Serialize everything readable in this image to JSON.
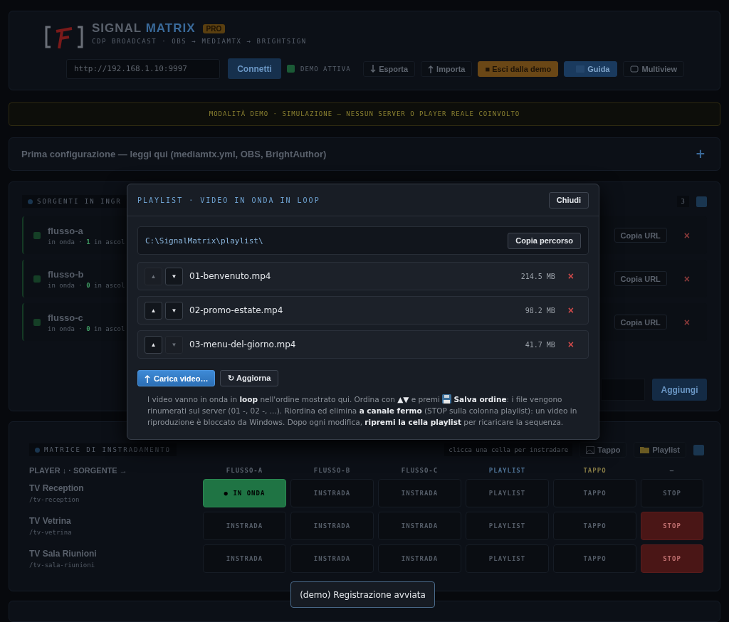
{
  "header": {
    "title_a": "SIGNAL",
    "title_b": "MATRIX",
    "badge": "PRO",
    "subtitle": "CDP BROADCAST · OBS → MEDIAMTX → BRIGHTSIGN",
    "server_url": "http://192.168.1.10:9997",
    "connect": "Connetti",
    "demo": {
      "label": "DEMO ATTIVA",
      "checked": true
    },
    "buttons": [
      {
        "kind": "export",
        "label": "Esporta"
      },
      {
        "kind": "import",
        "label": "Importa"
      },
      {
        "kind": "exit_demo",
        "label": "■ Esci dalla demo"
      },
      {
        "kind": "guide",
        "label": "Guida"
      },
      {
        "kind": "multiview",
        "label": "Multiview"
      }
    ]
  },
  "demo_banner": "MODALITÀ DEMO · SIMULAZIONE — NESSUN SERVER O PLAYER REALE COINVOLTO",
  "setup_accordion": {
    "title": "Prima configurazione — leggi qui (mediamtx.yml, OBS, BrightAuthor)",
    "toggle": "+",
    "expanded": false
  },
  "sources": {
    "title": "SORGENTI IN INGR",
    "count": "3",
    "items": [
      {
        "name": "flusso-a",
        "status": "in onda · ",
        "listeners": "1",
        "rest": " in ascol",
        "copy": "Copia URL",
        "delete": "×"
      },
      {
        "name": "flusso-b",
        "status": "in onda · ",
        "listeners": "0",
        "rest": " in ascol",
        "copy": "Copia URL",
        "delete": "×"
      },
      {
        "name": "flusso-c",
        "status": "in onda · ",
        "listeners": "0",
        "rest": " in ascol",
        "copy": "Copia URL",
        "delete": "×"
      }
    ],
    "add": "Aggiungi"
  },
  "matrix": {
    "title": "MATRICE DI INSTRADAMENTO",
    "hint": "clicca una cella per instradare",
    "tools": [
      {
        "kind": "tappo",
        "label": "Tappo"
      },
      {
        "kind": "playlist",
        "label": "Playlist"
      }
    ],
    "corner": "PLAYER ↓ · SORGENTE →",
    "columns": [
      {
        "label": "FLUSSO-A",
        "kind": "stream"
      },
      {
        "label": "FLUSSO-B",
        "kind": "stream"
      },
      {
        "label": "FLUSSO-C",
        "kind": "stream"
      },
      {
        "label": "PLAYLIST",
        "kind": "playlist"
      },
      {
        "label": "TAPPO",
        "kind": "tappo"
      },
      {
        "label": "—",
        "kind": "stop"
      }
    ],
    "rows": [
      {
        "name": "TV Reception",
        "path": "/tv-reception",
        "cells": [
          {
            "label": "● IN ONDA",
            "active": true
          },
          {
            "label": "INSTRADA",
            "active": false
          },
          {
            "label": "INSTRADA",
            "active": false
          },
          {
            "label": "PLAYLIST",
            "active": false
          },
          {
            "label": "TAPPO",
            "active": false
          },
          {
            "label": "STOP",
            "active": false
          }
        ]
      },
      {
        "name": "TV Vetrina",
        "path": "/tv-vetrina",
        "cells": [
          {
            "label": "INSTRADA",
            "active": false
          },
          {
            "label": "INSTRADA",
            "active": false
          },
          {
            "label": "INSTRADA",
            "active": false
          },
          {
            "label": "PLAYLIST",
            "active": false
          },
          {
            "label": "TAPPO",
            "active": false
          },
          {
            "label": "STOP",
            "active": true
          }
        ]
      },
      {
        "name": "TV Sala Riunioni",
        "path": "/tv-sala-riunioni",
        "cells": [
          {
            "label": "INSTRADA",
            "active": false
          },
          {
            "label": "INSTRADA",
            "active": false
          },
          {
            "label": "INSTRADA",
            "active": false
          },
          {
            "label": "PLAYLIST",
            "active": false
          },
          {
            "label": "TAPPO",
            "active": false
          },
          {
            "label": "STOP",
            "active": true
          }
        ]
      }
    ]
  },
  "modal": {
    "title": "PLAYLIST · VIDEO IN ONDA IN LOOP",
    "close": "Chiudi",
    "path": "C:\\SignalMatrix\\playlist\\",
    "copy_path": "Copia percorso",
    "files": [
      {
        "name": "01-benvenuto.mp4",
        "size": "214.5 MB",
        "up": {
          "label": "▲",
          "disabled": true
        },
        "down": {
          "label": "▼",
          "disabled": false
        },
        "delete": "×"
      },
      {
        "name": "02-promo-estate.mp4",
        "size": "98.2 MB",
        "up": {
          "label": "▲",
          "disabled": false
        },
        "down": {
          "label": "▼",
          "disabled": false
        },
        "delete": "×"
      },
      {
        "name": "03-menu-del-giorno.mp4",
        "size": "41.7 MB",
        "up": {
          "label": "▲",
          "disabled": false
        },
        "down": {
          "label": "▼",
          "disabled": true
        },
        "delete": "×"
      }
    ],
    "upload": "Carica video…",
    "refresh": "↻ Aggiorna",
    "note_before": "I video vanno in onda in **loop** nell'ordine mostrato qui. Ordina con **▲▼** e premi",
    "note_after": "**Salva ordine**: i file vengono rinumerati sul server (01 -, 02 -, ...). Riordina ed elimina **a canale fermo** (STOP sulla colonna playlist): un video in riproduzione è bloccato da Windows. Dopo ogni modifica, **ripremi la cella playlist** per ricaricare la sequenza."
  },
  "toast": "(demo) Registrazione avviata"
}
